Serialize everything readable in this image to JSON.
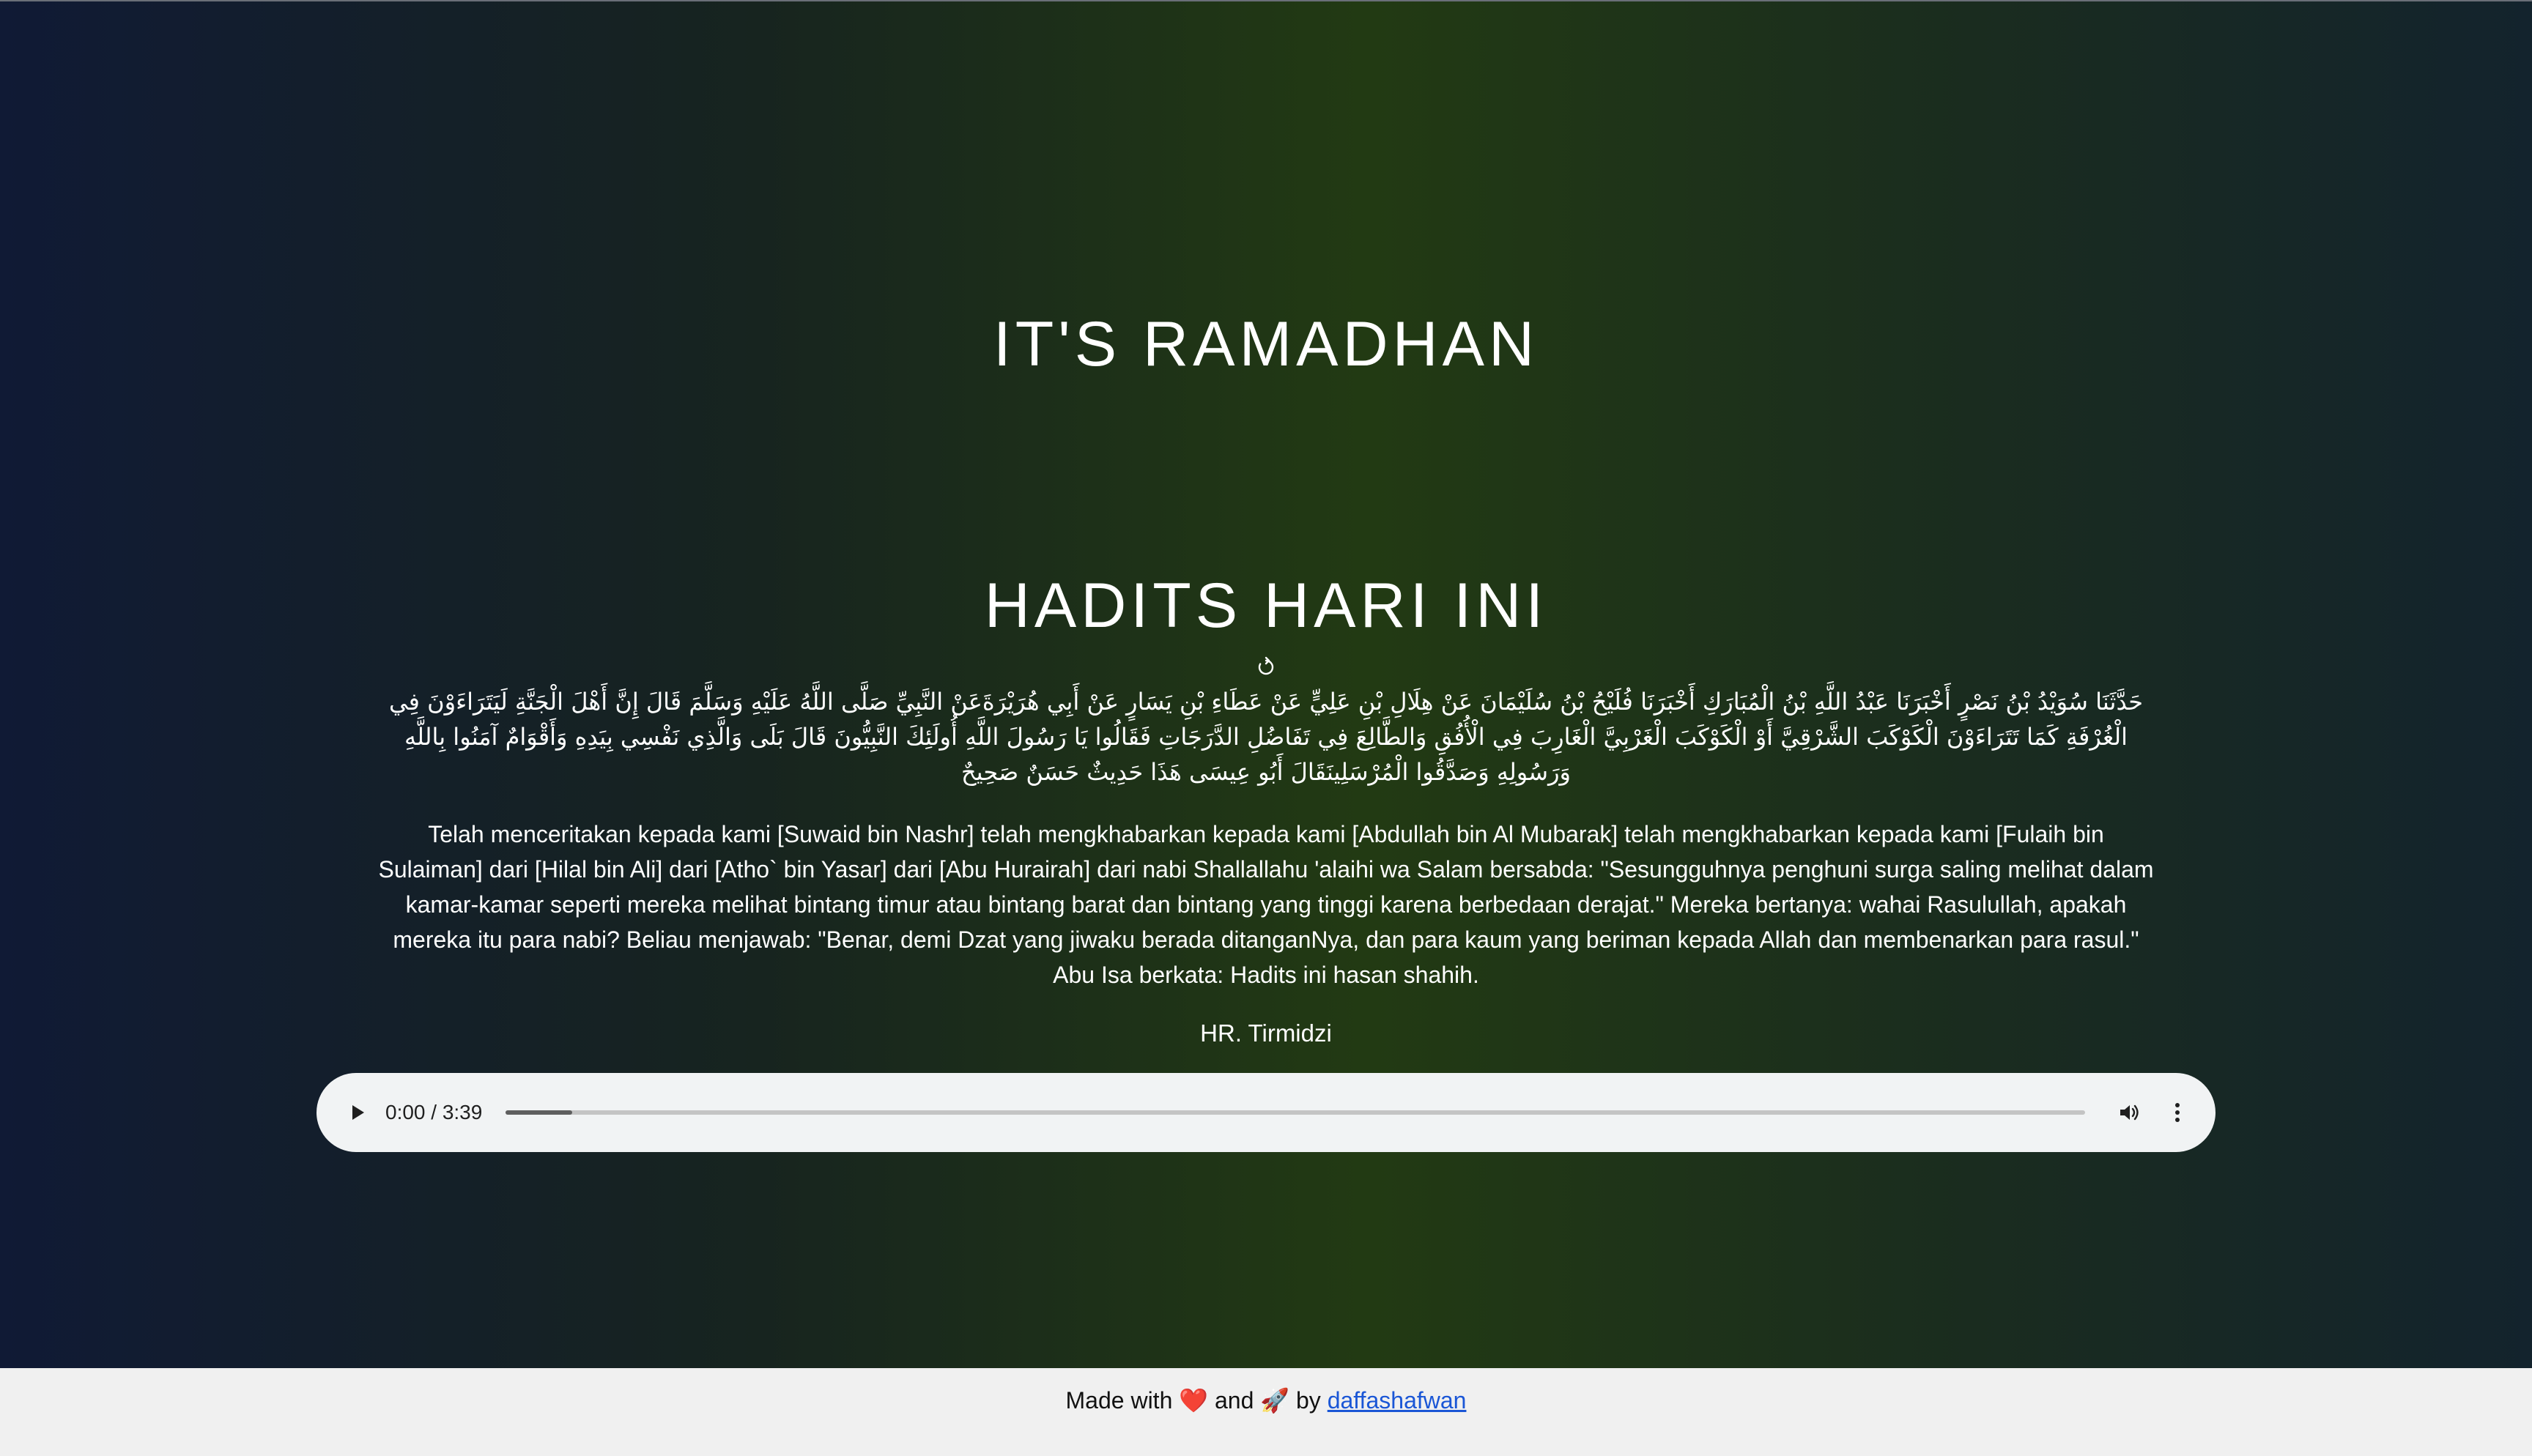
{
  "header": {
    "title": "IT'S RAMADHAN"
  },
  "hadith": {
    "heading": "HADITS HARI INI",
    "refresh_icon": "refresh-icon",
    "arabic": "حَدَّثَنَا سُوَيْدُ بْنُ نَصْرٍ أَخْبَرَنَا عَبْدُ اللَّهِ بْنُ الْمُبَارَكِ أَخْبَرَنَا فُلَيْحُ بْنُ سُلَيْمَانَ عَنْ هِلَالِ بْنِ عَلِيٍّ عَنْ عَطَاءِ بْنِ يَسَارٍ عَنْ أَبِي هُرَيْرَةَعَنْ النَّبِيِّ صَلَّى اللَّهُ عَلَيْهِ وَسَلَّمَ قَالَ إِنَّ أَهْلَ الْجَنَّةِ لَيَتَرَاءَوْنَ فِي الْغُرْفَةِ كَمَا تَتَرَاءَوْنَ الْكَوْكَبَ الشَّرْقِيَّ أَوْ الْكَوْكَبَ الْغَرْبِيَّ الْغَارِبَ فِي الْأُفُقِ وَالطَّالِعَ فِي تَفَاضُلِ الدَّرَجَاتِ فَقَالُوا يَا رَسُولَ اللَّهِ أُولَئِكَ النَّبِيُّونَ قَالَ بَلَى وَالَّذِي نَفْسِي بِيَدِهِ وَأَقْوَامٌ آمَنُوا بِاللَّهِ وَرَسُولِهِ وَصَدَّقُوا الْمُرْسَلِينَقَالَ أَبُو عِيسَى هَذَا حَدِيثٌ حَسَنٌ صَحِيحٌ",
    "translation": "Telah menceritakan kepada kami [Suwaid bin Nashr] telah mengkhabarkan kepada kami [Abdullah bin Al Mubarak] telah mengkhabarkan kepada kami [Fulaih bin Sulaiman] dari [Hilal bin Ali] dari [Atho` bin Yasar] dari [Abu Hurairah] dari nabi Shallallahu 'alaihi wa Salam bersabda: \"Sesungguhnya penghuni surga saling melihat dalam kamar-kamar seperti mereka melihat bintang timur atau bintang barat dan bintang yang tinggi karena berbedaan derajat.\" Mereka bertanya: wahai Rasulullah, apakah mereka itu para nabi? Beliau menjawab: \"Benar, demi Dzat yang jiwaku berada ditanganNya, dan para kaum yang beriman kepada Allah dan membenarkan para rasul.\" Abu Isa berkata: Hadits ini hasan shahih.",
    "source": "HR. Tirmidzi"
  },
  "audio_player": {
    "time_display": "0:00 / 3:39",
    "progress_fraction": 0.042,
    "play_icon": "play-icon",
    "volume_icon": "volume-icon",
    "more_icon": "more-vertical-icon"
  },
  "footer": {
    "prefix": "Made with",
    "heart": "❤️",
    "and": "and",
    "rocket": "🚀",
    "by": "by",
    "author_link": "daffashafwan"
  },
  "colors": {
    "gradient_left": "#101a35",
    "gradient_center": "#223a13",
    "gradient_right": "#13232d",
    "footer_bg": "#f0f0f0",
    "link": "#1a56d6",
    "player_bg": "#f1f3f4"
  }
}
